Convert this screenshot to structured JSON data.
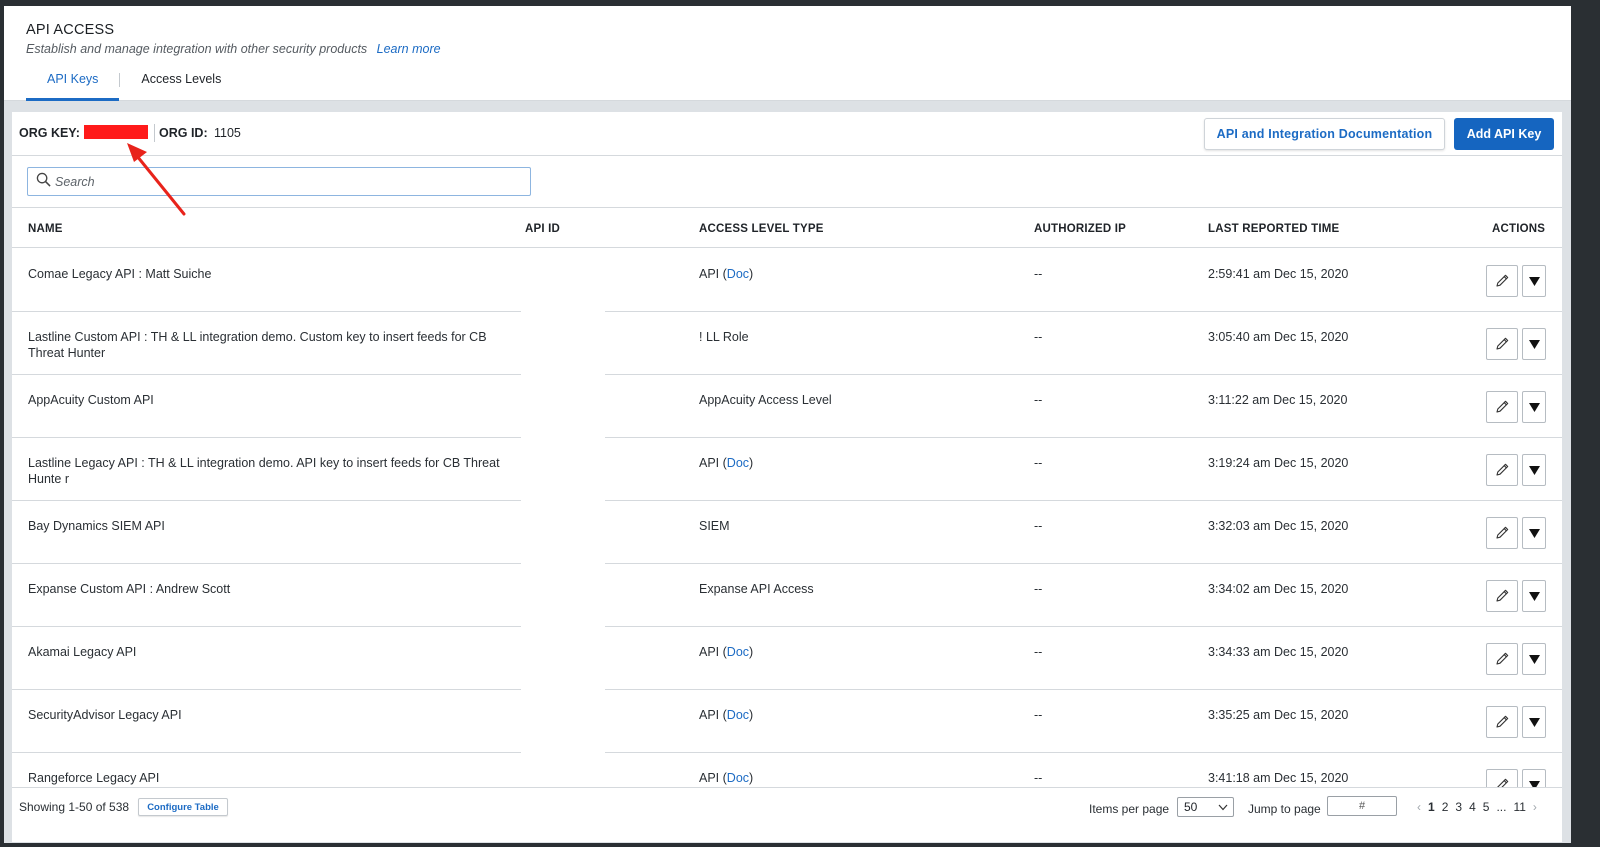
{
  "header": {
    "title": "API ACCESS",
    "subtitle": "Establish and manage integration with other security products",
    "learn_more": "Learn more",
    "tabs": [
      {
        "label": "API Keys",
        "active": true
      },
      {
        "label": "Access Levels",
        "active": false
      }
    ]
  },
  "org": {
    "org_key_label": "ORG KEY:",
    "org_id_label": "ORG ID:",
    "org_id_value": "1105",
    "redaction_color": "#ff1a1a"
  },
  "toolbar": {
    "doc_button": "API and Integration Documentation",
    "add_button": "Add API Key"
  },
  "search": {
    "placeholder": "Search",
    "value": ""
  },
  "table": {
    "columns": [
      "NAME",
      "API ID",
      "ACCESS LEVEL TYPE",
      "AUTHORIZED IP",
      "LAST REPORTED TIME",
      "ACTIONS"
    ],
    "rows": [
      {
        "name": "Comae Legacy API : Matt Suiche",
        "access_prefix": "API (",
        "access_link": "Doc",
        "access_suffix": ")",
        "access": "",
        "authorized_ip": "--",
        "time": "2:59:41 am Dec 15, 2020"
      },
      {
        "name": "Lastline Custom API : TH & LL integration demo. Custom key to insert feeds for CB Threat Hunter",
        "access": "! LL Role",
        "authorized_ip": "--",
        "time": "3:05:40 am Dec 15, 2020"
      },
      {
        "name": "AppAcuity Custom API",
        "access": "AppAcuity Access Level",
        "authorized_ip": "--",
        "time": "3:11:22 am Dec 15, 2020"
      },
      {
        "name": "Lastline Legacy API : TH & LL integration demo. API key to insert feeds for CB Threat Hunte r",
        "access_prefix": "API (",
        "access_link": "Doc",
        "access_suffix": ")",
        "access": "",
        "authorized_ip": "--",
        "time": "3:19:24 am Dec 15, 2020"
      },
      {
        "name": "Bay Dynamics SIEM API",
        "access": "SIEM",
        "authorized_ip": "--",
        "time": "3:32:03 am Dec 15, 2020"
      },
      {
        "name": "Expanse Custom API : Andrew Scott",
        "access": "Expanse API Access",
        "authorized_ip": "--",
        "time": "3:34:02 am Dec 15, 2020"
      },
      {
        "name": "Akamai Legacy API",
        "access_prefix": "API (",
        "access_link": "Doc",
        "access_suffix": ")",
        "access": "",
        "authorized_ip": "--",
        "time": "3:34:33 am Dec 15, 2020"
      },
      {
        "name": "SecurityAdvisor Legacy API",
        "access_prefix": "API (",
        "access_link": "Doc",
        "access_suffix": ")",
        "access": "",
        "authorized_ip": "--",
        "time": "3:35:25 am Dec 15, 2020"
      },
      {
        "name": "Rangeforce Legacy API",
        "access_prefix": "API (",
        "access_link": "Doc",
        "access_suffix": ")",
        "access": "",
        "authorized_ip": "--",
        "time": "3:41:18 am Dec 15, 2020"
      }
    ],
    "action_icons": [
      "pencil-icon",
      "caret-down-icon"
    ]
  },
  "footer": {
    "showing": "Showing 1-50 of 538",
    "configure_table": "Configure Table",
    "items_per_page_label": "Items per page",
    "items_per_page_value": "50",
    "jump_label": "Jump to page",
    "jump_placeholder": "#",
    "pages": [
      "1",
      "2",
      "3",
      "4",
      "5",
      "...",
      "11"
    ],
    "current_page": "1",
    "prev_icon": "chevron-left-icon",
    "next_icon": "chevron-right-icon"
  },
  "colors": {
    "accent": "#1c6bc4",
    "primary_button": "#1565c0",
    "annotation_arrow": "#e8231b"
  }
}
